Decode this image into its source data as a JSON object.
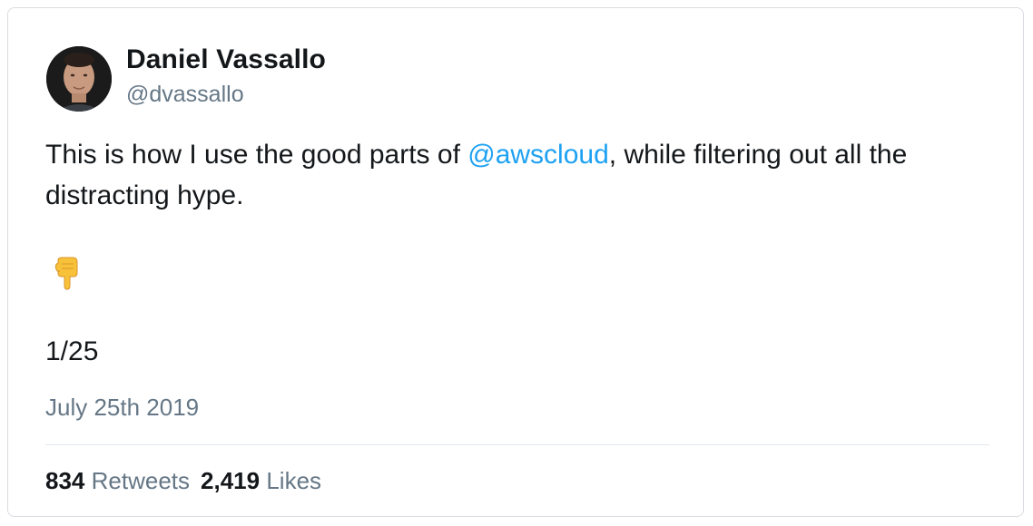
{
  "author": {
    "name": "Daniel Vassallo",
    "handle": "@dvassallo"
  },
  "tweet": {
    "text_before": "This is how I use the good parts of ",
    "mention": "@awscloud",
    "text_after": ", while filtering out all the distracting hype.",
    "emoji": "pointing-down-emoji",
    "thread_count": "1/25",
    "date": "July 25th 2019"
  },
  "stats": {
    "retweets_count": "834",
    "retweets_label": "Retweets",
    "likes_count": "2,419",
    "likes_label": "Likes"
  },
  "colors": {
    "mention": "#1da1f2",
    "secondary_text": "#657786",
    "primary_text": "#14171a"
  }
}
